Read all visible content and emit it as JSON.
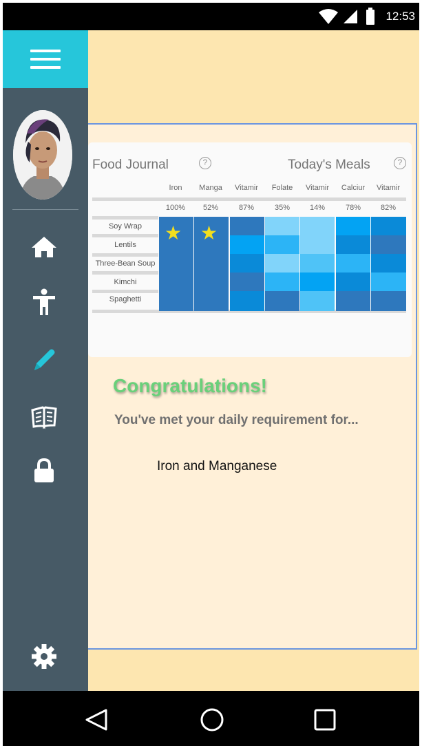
{
  "status_bar": {
    "time": "12:53"
  },
  "journal": {
    "title": "Food Journal",
    "meals_title": "Today's Meals",
    "help_glyph": "?",
    "columns": [
      {
        "name": "Iron",
        "pct": "100%"
      },
      {
        "name": "Manga",
        "pct": "52%"
      },
      {
        "name": "Vitamir",
        "pct": "87%"
      },
      {
        "name": "Folate",
        "pct": "35%"
      },
      {
        "name": "Vitamir",
        "pct": "14%"
      },
      {
        "name": "Calciur",
        "pct": "78%"
      },
      {
        "name": "Vitamir",
        "pct": "82%"
      }
    ],
    "foods": [
      "Soy Wrap",
      "Lentils",
      "Three-Bean Soup",
      "Kimchi",
      "Spaghetti"
    ],
    "star_glyph": "★",
    "colors": {
      "blue_dark": "#2e78bd",
      "blue_mid": "#0a8ad8",
      "blue_bright": "#03a3f3",
      "blue_light": "#2cb4f6",
      "blue_pale": "#81d4fa",
      "star": "#f2de1f"
    }
  },
  "message": {
    "congrats": "Congratulations!",
    "requirement": "You've met your daily requirement for...",
    "nutrients": "Iron and Manganese"
  },
  "sidebar": {
    "items": [
      {
        "icon": "home-icon"
      },
      {
        "icon": "person-icon"
      },
      {
        "icon": "pencil-icon"
      },
      {
        "icon": "book-icon"
      },
      {
        "icon": "lock-icon"
      }
    ],
    "settings_icon": "gear-icon",
    "accent": "#26c6da",
    "background": "#475a66"
  }
}
